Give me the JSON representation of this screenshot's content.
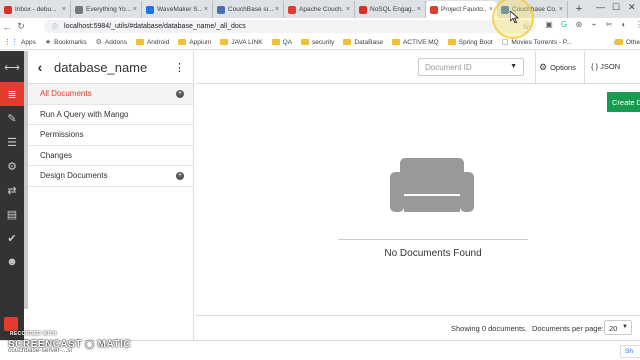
{
  "browser": {
    "tabs": [
      {
        "title": "Inbox - debu...",
        "fav_color": "#d93025",
        "active": false
      },
      {
        "title": "Everything Yo...",
        "fav_color": "#777777",
        "active": false
      },
      {
        "title": "WaveMaker S...",
        "fav_color": "#1a73e8",
        "active": false
      },
      {
        "title": "CouchBase si...",
        "fav_color": "#4b6fb5",
        "active": false
      },
      {
        "title": "Apache Couch...",
        "fav_color": "#e33b2e",
        "active": false
      },
      {
        "title": "NoSQL Engag...",
        "fav_color": "#d93025",
        "active": false
      },
      {
        "title": "Project Fauxto...",
        "fav_color": "#e33b2e",
        "active": true
      },
      {
        "title": "Couchbase Co...",
        "fav_color": "#2b6cc4",
        "active": false
      }
    ],
    "new_tab": "+",
    "url": "localhost:5984/_utils/#database/database_name/_all_docs",
    "bookmarks": [
      {
        "label": "Apps",
        "kind": "apps"
      },
      {
        "label": "Bookmarks",
        "kind": "star"
      },
      {
        "label": "Addons",
        "kind": "gear"
      },
      {
        "label": "Android",
        "kind": "folder"
      },
      {
        "label": "Appium",
        "kind": "folder"
      },
      {
        "label": "JAVA LINK",
        "kind": "folder"
      },
      {
        "label": "QA",
        "kind": "folder"
      },
      {
        "label": "security",
        "kind": "folder"
      },
      {
        "label": "DataBase",
        "kind": "folder"
      },
      {
        "label": "ACTIVE MQ",
        "kind": "folder"
      },
      {
        "label": "Spring Boot",
        "kind": "folder"
      },
      {
        "label": "Movies Torrents - P...",
        "kind": "page"
      }
    ],
    "bookmarks_more": "»",
    "other_bookmarks": "Othe"
  },
  "sidebar": {
    "title": "database_name",
    "items": [
      {
        "label": "All Documents",
        "active": true,
        "plus": true
      },
      {
        "label": "Run A Query with Mango",
        "active": false,
        "plus": false
      },
      {
        "label": "Permissions",
        "active": false,
        "plus": false
      },
      {
        "label": "Changes",
        "active": false,
        "plus": false
      },
      {
        "label": "Design Documents",
        "active": false,
        "plus": true
      }
    ]
  },
  "header": {
    "docid_placeholder": "Document ID",
    "options_label": "Options",
    "json_label": "{ } JSON",
    "create_label": "Create D"
  },
  "main": {
    "empty_message": "No Documents Found"
  },
  "footer": {
    "showing": "Showing 0 documents.",
    "per_page_label": "Documents per page:",
    "per_page_value": "20"
  },
  "downloads": {
    "item": "couchbase-server-...si",
    "show_all": "Sh"
  },
  "watermark": {
    "top": "RECORDED WITH",
    "main": "SCREENCAST ◉ MATIC"
  },
  "colors": {
    "accent_red": "#e33b2e",
    "create_green": "#179c52",
    "rail_bg": "#333333"
  }
}
